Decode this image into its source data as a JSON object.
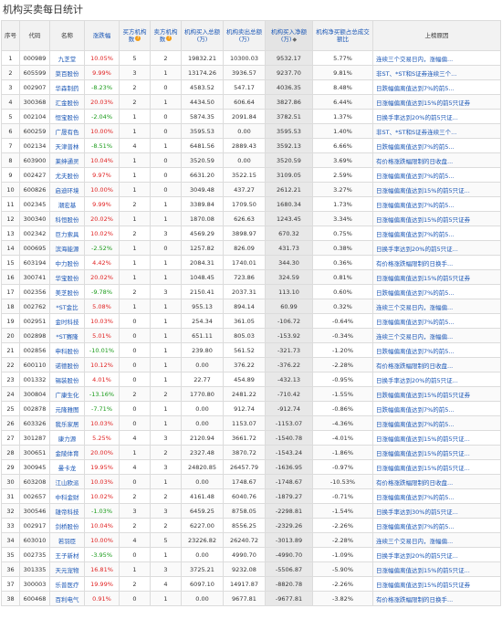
{
  "page_title": "机构买卖每日统计",
  "headers": {
    "seq": "序号",
    "code": "代码",
    "name": "名称",
    "change": "涨跌幅",
    "buy_count": "买方机构数",
    "sell_count": "卖方机构数",
    "buy_amt": "机构买入总额(万)",
    "sell_amt": "机构卖出总额(万)",
    "net_amt": "机构买入净额(万)",
    "ratio": "机构净买额占总成交额比",
    "reason": "上榜原因"
  },
  "rows": [
    [
      "1",
      "000989",
      "九芝堂",
      "10.05%",
      "5",
      "2",
      "19832.21",
      "10300.03",
      "9532.17",
      "5.77%",
      "连续三个交易日内，涨幅偏..."
    ],
    [
      "2",
      "605599",
      "菜百股份",
      "9.99%",
      "3",
      "1",
      "13174.26",
      "3936.57",
      "9237.70",
      "9.81%",
      "非ST、*ST和S证券连续三个..."
    ],
    [
      "3",
      "002907",
      "华森制药",
      "-8.23%",
      "2",
      "0",
      "4583.52",
      "547.17",
      "4036.35",
      "8.48%",
      "日跌幅偏离值达到7%的前5..."
    ],
    [
      "4",
      "300368",
      "汇金股份",
      "20.03%",
      "2",
      "1",
      "4434.50",
      "606.64",
      "3827.86",
      "6.44%",
      "日涨幅偏离值达到15%的前5只证券"
    ],
    [
      "5",
      "002104",
      "恒宝股份",
      "-2.04%",
      "1",
      "0",
      "5874.35",
      "2091.84",
      "3782.51",
      "1.37%",
      "日换手率达到20%的前5只证..."
    ],
    [
      "6",
      "600259",
      "广晟有色",
      "10.00%",
      "1",
      "0",
      "3595.53",
      "0.00",
      "3595.53",
      "1.40%",
      "非ST、*ST和S证券连续三个..."
    ],
    [
      "7",
      "002134",
      "天津普林",
      "-8.51%",
      "4",
      "1",
      "6481.56",
      "2889.43",
      "3592.13",
      "6.66%",
      "日跌幅偏离值达到7%的前5..."
    ],
    [
      "8",
      "603900",
      "莱绅通灵",
      "10.04%",
      "1",
      "0",
      "3520.59",
      "0.00",
      "3520.59",
      "3.69%",
      "有价格涨跌幅限制的日收盘..."
    ],
    [
      "9",
      "002427",
      "尤夫股份",
      "9.97%",
      "1",
      "0",
      "6631.20",
      "3522.15",
      "3109.05",
      "2.59%",
      "日涨幅偏离值达到7%的前5..."
    ],
    [
      "10",
      "600826",
      "启迪环境",
      "10.00%",
      "1",
      "0",
      "3049.48",
      "437.27",
      "2612.21",
      "3.27%",
      "日涨幅偏离值达到15%的前5只证..."
    ],
    [
      "11",
      "002345",
      "潮宏基",
      "9.99%",
      "2",
      "1",
      "3389.84",
      "1709.50",
      "1680.34",
      "1.73%",
      "日涨幅偏离值达到7%的前5..."
    ],
    [
      "12",
      "300340",
      "科恒股份",
      "20.02%",
      "1",
      "1",
      "1870.08",
      "626.63",
      "1243.45",
      "3.34%",
      "日涨幅偏离值达到15%的前5只证券"
    ],
    [
      "13",
      "002342",
      "巨力索具",
      "10.02%",
      "2",
      "3",
      "4569.29",
      "3898.97",
      "670.32",
      "0.75%",
      "日涨幅偏离值达到7%的前5..."
    ],
    [
      "14",
      "000695",
      "滨海能源",
      "-2.52%",
      "1",
      "0",
      "1257.82",
      "826.09",
      "431.73",
      "0.38%",
      "日换手率达到20%的前5只证..."
    ],
    [
      "15",
      "603194",
      "中力股份",
      "4.42%",
      "1",
      "1",
      "2084.31",
      "1740.01",
      "344.30",
      "0.36%",
      "有价格涨跌幅限制的日换手..."
    ],
    [
      "16",
      "300741",
      "华宝股份",
      "20.02%",
      "1",
      "1",
      "1048.45",
      "723.86",
      "324.59",
      "0.81%",
      "日涨幅偏离值达到15%的前5只证券"
    ],
    [
      "17",
      "002356",
      "美芝股份",
      "-9.78%",
      "2",
      "3",
      "2150.41",
      "2037.31",
      "113.10",
      "0.60%",
      "日跌幅偏离值达到7%的前5..."
    ],
    [
      "18",
      "002762",
      "*ST金比",
      "5.08%",
      "1",
      "1",
      "955.13",
      "894.14",
      "60.99",
      "0.32%",
      "连续三个交易日内，涨幅偏..."
    ],
    [
      "19",
      "002951",
      "金时科技",
      "10.03%",
      "0",
      "1",
      "254.34",
      "361.05",
      "-106.72",
      "-0.64%",
      "日涨幅偏离值达到7%的前5..."
    ],
    [
      "20",
      "002898",
      "*ST赛隆",
      "5.01%",
      "0",
      "1",
      "651.11",
      "805.03",
      "-153.92",
      "-0.34%",
      "连续三个交易日内，涨幅偏..."
    ],
    [
      "21",
      "002856",
      "申科股份",
      "-10.01%",
      "0",
      "1",
      "239.80",
      "561.52",
      "-321.73",
      "-1.20%",
      "日跌幅偏离值达到7%的前5..."
    ],
    [
      "22",
      "600110",
      "诺德股份",
      "10.12%",
      "0",
      "1",
      "0.00",
      "376.22",
      "-376.22",
      "-2.28%",
      "有价格涨跌幅限制的日收盘..."
    ],
    [
      "23",
      "001332",
      "锡装股份",
      "4.01%",
      "0",
      "1",
      "22.77",
      "454.89",
      "-432.13",
      "-0.95%",
      "日换手率达到20%的前5只证..."
    ],
    [
      "24",
      "300804",
      "广康生化",
      "-13.16%",
      "2",
      "2",
      "1770.80",
      "2481.22",
      "-710.42",
      "-1.55%",
      "日跌幅偏离值达到15%的前5只证券"
    ],
    [
      "25",
      "002878",
      "元隆雅图",
      "-7.71%",
      "0",
      "1",
      "0.00",
      "912.74",
      "-912.74",
      "-0.86%",
      "日跌幅偏离值达到7%的前5..."
    ],
    [
      "26",
      "603326",
      "我乐家居",
      "10.03%",
      "0",
      "1",
      "0.00",
      "1153.07",
      "-1153.07",
      "-4.36%",
      "日涨幅偏离值达到7%的前5..."
    ],
    [
      "27",
      "301287",
      "康力源",
      "5.25%",
      "4",
      "3",
      "2120.94",
      "3661.72",
      "-1540.78",
      "-4.01%",
      "日涨幅偏离值达到15%的前5只证..."
    ],
    [
      "28",
      "300651",
      "金陵体育",
      "20.00%",
      "1",
      "2",
      "2327.48",
      "3870.72",
      "-1543.24",
      "-1.86%",
      "日涨幅偏离值达到15%的前5只证..."
    ],
    [
      "29",
      "300945",
      "曼卡龙",
      "19.95%",
      "4",
      "3",
      "24820.85",
      "26457.79",
      "-1636.95",
      "-0.97%",
      "日涨幅偏离值达到15%的前5只证..."
    ],
    [
      "30",
      "603208",
      "江山欧派",
      "10.03%",
      "0",
      "1",
      "0.00",
      "1748.67",
      "-1748.67",
      "-10.53%",
      "有价格涨跌幅限制的日收盘..."
    ],
    [
      "31",
      "002657",
      "中科金财",
      "10.02%",
      "2",
      "2",
      "4161.48",
      "6040.76",
      "-1879.27",
      "-0.71%",
      "日涨幅偏离值达到7%的前5..."
    ],
    [
      "32",
      "300546",
      "雄帝科技",
      "-1.03%",
      "3",
      "3",
      "6459.25",
      "8758.05",
      "-2298.81",
      "-1.54%",
      "日换手率达到30%的前5只证..."
    ],
    [
      "33",
      "002917",
      "剑桥股份",
      "10.04%",
      "2",
      "2",
      "6227.00",
      "8556.25",
      "-2329.26",
      "-2.26%",
      "日涨幅偏离值达到7%的前5..."
    ],
    [
      "34",
      "603010",
      "若羽臣",
      "10.00%",
      "4",
      "5",
      "23226.82",
      "26240.72",
      "-3013.89",
      "-2.28%",
      "连续三个交易日内，涨幅偏..."
    ],
    [
      "35",
      "002735",
      "王子新材",
      "-3.95%",
      "0",
      "1",
      "0.00",
      "4990.70",
      "-4990.70",
      "-1.09%",
      "日换手率达到20%的前5只证..."
    ],
    [
      "36",
      "301335",
      "天元宠物",
      "16.81%",
      "1",
      "3",
      "3725.21",
      "9232.08",
      "-5506.87",
      "-5.90%",
      "日涨幅偏离值达到15%的前5只证..."
    ],
    [
      "37",
      "300003",
      "乐普医疗",
      "19.99%",
      "2",
      "4",
      "6097.10",
      "14917.87",
      "-8820.78",
      "-2.26%",
      "日涨幅偏离值达到15%的前5只证券"
    ],
    [
      "38",
      "600468",
      "百利电气",
      "0.91%",
      "0",
      "1",
      "0.00",
      "9677.81",
      "-9677.81",
      "-3.82%",
      "有价格涨跌幅限制的日换手..."
    ]
  ],
  "icons": {
    "badge": "info-badge-icon",
    "sort": "sort-arrows-icon"
  },
  "colors": {
    "up": "#e02222",
    "down": "#1a9b1a",
    "link": "#1b57b6",
    "highlight": "#e8e8e8"
  }
}
